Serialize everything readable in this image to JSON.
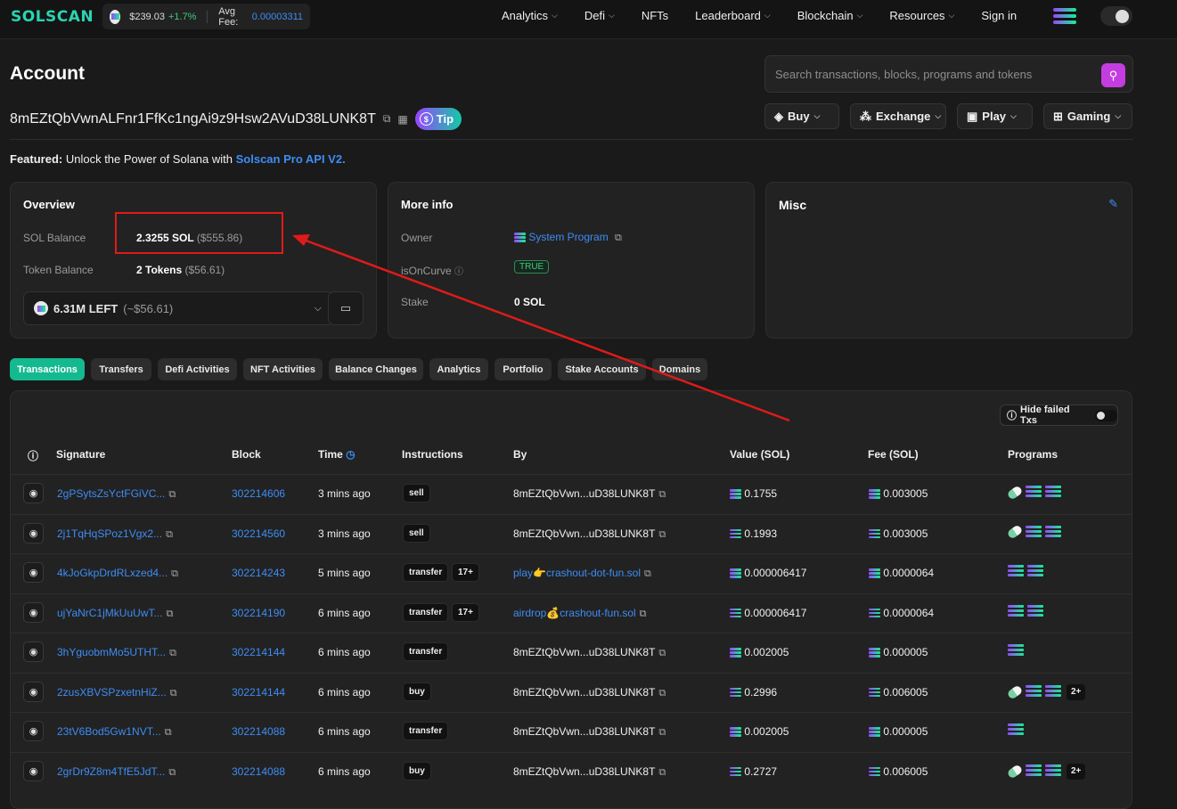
{
  "topbar": {
    "logo": "SOLSCAN",
    "sol_price": "$239.03",
    "sol_change": "+1.7%",
    "avg_fee_label": "Avg Fee:",
    "avg_fee_value": "0.00003311",
    "nav": [
      {
        "label": "Analytics",
        "dropdown": true
      },
      {
        "label": "Defi",
        "dropdown": true
      },
      {
        "label": "NFTs",
        "dropdown": false
      },
      {
        "label": "Leaderboard",
        "dropdown": true
      },
      {
        "label": "Blockchain",
        "dropdown": true
      },
      {
        "label": "Resources",
        "dropdown": true
      },
      {
        "label": "Sign in",
        "dropdown": false
      }
    ]
  },
  "header": {
    "title": "Account",
    "address": "8mEZtQbVwnALFnr1FfKc1ngAi9z9Hsw2AVuD38LUNK8T",
    "tip_label": "Tip",
    "search_placeholder": "Search transactions, blocks, programs and tokens",
    "actions": [
      "Buy",
      "Exchange",
      "Play",
      "Gaming"
    ]
  },
  "featured": {
    "prefix": "Featured:",
    "text": " Unlock the Power of Solana with ",
    "link": "Solscan Pro API V2."
  },
  "overview": {
    "title": "Overview",
    "sol_balance_label": "SOL Balance",
    "sol_balance": "2.3255 SOL",
    "sol_balance_usd": "($555.86)",
    "token_balance_label": "Token Balance",
    "token_balance": "2 Tokens",
    "token_balance_usd": "($56.61)",
    "token_select": "6.31M LEFT",
    "token_select_usd": "(~$56.61)"
  },
  "moreinfo": {
    "title": "More info",
    "owner_label": "Owner",
    "owner_value": "System Program",
    "curve_label": "isOnCurve",
    "curve_value": "TRUE",
    "stake_label": "Stake",
    "stake_value": "0 SOL"
  },
  "misc": {
    "title": "Misc"
  },
  "tabs": [
    "Transactions",
    "Transfers",
    "Defi Activities",
    "NFT Activities",
    "Balance Changes",
    "Analytics",
    "Portfolio",
    "Stake Accounts",
    "Domains"
  ],
  "table": {
    "hide_failed_label": "Hide failed Txs",
    "headers": [
      "Signature",
      "Block",
      "Time",
      "Instructions",
      "By",
      "Value (SOL)",
      "Fee (SOL)",
      "Programs"
    ],
    "rows": [
      {
        "sig": "2gPSytsZsYctFGiVC...",
        "block": "302214606",
        "time": "3 mins ago",
        "instr": "sell",
        "instr_more": "",
        "by": "8mEZtQbVwn...uD38LUNK8T",
        "by_link": false,
        "value": "0.1755",
        "fee": "0.003005",
        "progs": "pill2",
        "more": ""
      },
      {
        "sig": "2j1TqHqSPoz1Vgx2...",
        "block": "302214560",
        "time": "3 mins ago",
        "instr": "sell",
        "instr_more": "",
        "by": "8mEZtQbVwn...uD38LUNK8T",
        "by_link": false,
        "value": "0.1993",
        "fee": "0.003005",
        "progs": "pill2",
        "more": ""
      },
      {
        "sig": "4kJoGkpDrdRLxzed4...",
        "block": "302214243",
        "time": "5 mins ago",
        "instr": "transfer",
        "instr_more": "17+",
        "by": "play👉crashout-dot-fun.sol",
        "by_link": true,
        "value": "0.000006417",
        "fee": "0.0000064",
        "progs": "sol2",
        "more": ""
      },
      {
        "sig": "ujYaNrC1jMkUuUwT...",
        "block": "302214190",
        "time": "6 mins ago",
        "instr": "transfer",
        "instr_more": "17+",
        "by": "airdrop💰crashout-fun.sol",
        "by_link": true,
        "value": "0.000006417",
        "fee": "0.0000064",
        "progs": "sol2",
        "more": ""
      },
      {
        "sig": "3hYguobmMo5UTHT...",
        "block": "302214144",
        "time": "6 mins ago",
        "instr": "transfer",
        "instr_more": "",
        "by": "8mEZtQbVwn...uD38LUNK8T",
        "by_link": false,
        "value": "0.002005",
        "fee": "0.000005",
        "progs": "sol1",
        "more": ""
      },
      {
        "sig": "2zusXBVSPzxetnHiZ...",
        "block": "302214144",
        "time": "6 mins ago",
        "instr": "buy",
        "instr_more": "",
        "by": "8mEZtQbVwn...uD38LUNK8T",
        "by_link": false,
        "value": "0.2996",
        "fee": "0.006005",
        "progs": "pill2",
        "more": "2+"
      },
      {
        "sig": "23tV6Bod5Gw1NVT...",
        "block": "302214088",
        "time": "6 mins ago",
        "instr": "transfer",
        "instr_more": "",
        "by": "8mEZtQbVwn...uD38LUNK8T",
        "by_link": false,
        "value": "0.002005",
        "fee": "0.000005",
        "progs": "sol1",
        "more": ""
      },
      {
        "sig": "2grDr9Z8m4TfE5JdT...",
        "block": "302214088",
        "time": "6 mins ago",
        "instr": "buy",
        "instr_more": "",
        "by": "8mEZtQbVwn...uD38LUNK8T",
        "by_link": false,
        "value": "0.2727",
        "fee": "0.006005",
        "progs": "pill2",
        "more": "2+"
      }
    ]
  },
  "colors": {
    "accent": "#14b98f",
    "link": "#3d8df5",
    "annotation": "#e01a1a"
  }
}
